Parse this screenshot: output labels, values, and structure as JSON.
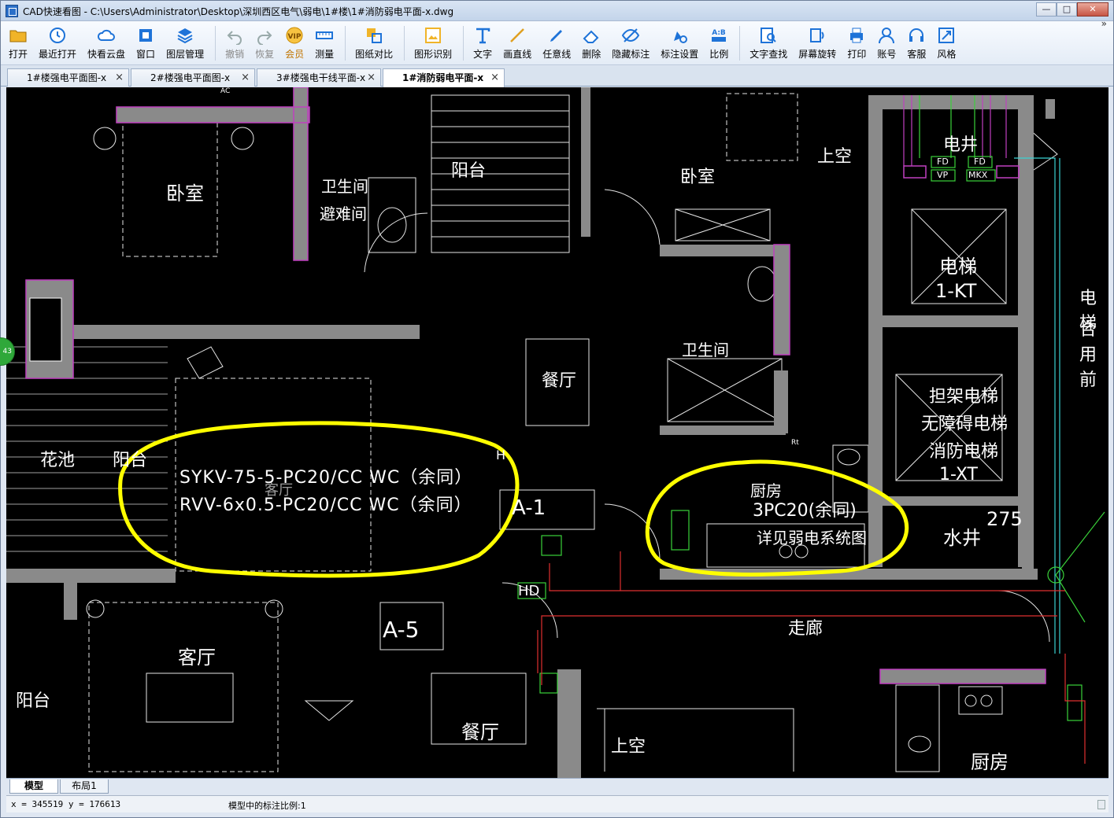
{
  "window": {
    "title": "CAD快速看图 - C:\\Users\\Administrator\\Desktop\\深圳西区电气\\弱电\\1#楼\\1#消防弱电平面-x.dwg",
    "buttons": {
      "minimize": "—",
      "maximize": "□",
      "close": "✕"
    }
  },
  "toolbar": {
    "groups": [
      [
        {
          "id": "open",
          "label": "打开",
          "icon": "folder-icon"
        },
        {
          "id": "recent",
          "label": "最近打开",
          "icon": "clock-icon"
        },
        {
          "id": "cloud",
          "label": "快看云盘",
          "icon": "cloud-icon"
        },
        {
          "id": "window",
          "label": "窗口",
          "icon": "window-icon"
        },
        {
          "id": "layers",
          "label": "图层管理",
          "icon": "layers-icon"
        }
      ],
      [
        {
          "id": "undo",
          "label": "撤销",
          "icon": "undo-icon",
          "disabled": true
        },
        {
          "id": "redo",
          "label": "恢复",
          "icon": "redo-icon",
          "disabled": true
        },
        {
          "id": "vip",
          "label": "会员",
          "icon": "vip-icon",
          "vip": true
        },
        {
          "id": "measure",
          "label": "测量",
          "icon": "ruler-icon"
        }
      ],
      [
        {
          "id": "compare",
          "label": "图纸对比",
          "icon": "compare-icon"
        }
      ],
      [
        {
          "id": "recognize",
          "label": "图形识别",
          "icon": "image-recognize-icon"
        }
      ],
      [
        {
          "id": "text",
          "label": "文字",
          "icon": "text-icon"
        },
        {
          "id": "line",
          "label": "画直线",
          "icon": "line-icon"
        },
        {
          "id": "freeline",
          "label": "任意线",
          "icon": "pen-icon"
        },
        {
          "id": "delete",
          "label": "删除",
          "icon": "eraser-icon"
        },
        {
          "id": "hide",
          "label": "隐藏标注",
          "icon": "hide-eye-icon"
        },
        {
          "id": "annot",
          "label": "标注设置",
          "icon": "annotation-settings-icon"
        },
        {
          "id": "ratio",
          "label": "比例",
          "icon": "ratio-icon"
        }
      ],
      [
        {
          "id": "find",
          "label": "文字查找",
          "icon": "find-text-icon"
        },
        {
          "id": "rotate",
          "label": "屏幕旋转",
          "icon": "rotate-icon"
        },
        {
          "id": "print",
          "label": "打印",
          "icon": "printer-icon"
        },
        {
          "id": "account",
          "label": "账号",
          "icon": "user-icon"
        },
        {
          "id": "service",
          "label": "客服",
          "icon": "headset-icon"
        },
        {
          "id": "style",
          "label": "风格",
          "icon": "style-icon"
        }
      ]
    ],
    "more": "»"
  },
  "tabs": [
    {
      "label": "1#楼强电平面图-x",
      "active": false
    },
    {
      "label": "2#楼强电平面图-x",
      "active": false
    },
    {
      "label": "3#楼强电干线平面-x",
      "active": false
    },
    {
      "label": "1#消防弱电平面-x",
      "active": true
    }
  ],
  "tab_close": "×",
  "drawing": {
    "rooms": {
      "bedroom_top_left": "卧室",
      "bathroom_top": "卫生间",
      "refuge": "避难间",
      "balcony_top": "阳台",
      "bedroom_top_right": "卧室",
      "void_top": "上空",
      "elec_shaft": "电井",
      "elevator": "电梯",
      "elevator_code": "1-KT",
      "elevator_right_1": "电梯",
      "elevator_right_2": "合用前",
      "bathroom_mid": "卫生间",
      "dining_mid": "餐厅",
      "flower_pool": "花池",
      "balcony_left": "阳台",
      "living_mid": "客厅",
      "stretcher_1": "担架电梯",
      "stretcher_2": "无障碍电梯",
      "stretcher_3": "消防电梯",
      "stretcher_code": "1-XT",
      "kitchen_mid": "厨房",
      "water_shaft": "水井",
      "corridor": "走廊",
      "living_bottom": "客厅",
      "balcony_bottom": "阳台",
      "dining_bottom": "餐厅",
      "void_bottom": "上空",
      "kitchen_bottom": "厨房"
    },
    "labels": {
      "cable_1": "SYKV-75-5-PC20/CC WC（余同）",
      "cable_2": "RVV-6x0.5-PC20/CC WC（余同）",
      "pc_note": "3PC20(余同)",
      "see_system": "详见弱电系统图",
      "unit_a1": "A-1",
      "unit_a5": "A-5",
      "hd": "HD",
      "num_275": "275",
      "fd1": "FD",
      "fd2": "FD",
      "vp": "VP",
      "mkx": "MKX",
      "ac": "AC",
      "rt": "Rt",
      "h_mark": "H"
    }
  },
  "layout_tabs": [
    "模型",
    "布局1"
  ],
  "status": {
    "coords": "x = 345519 y = 176613",
    "scale_text": "模型中的标注比例:1",
    "badge": "43"
  }
}
